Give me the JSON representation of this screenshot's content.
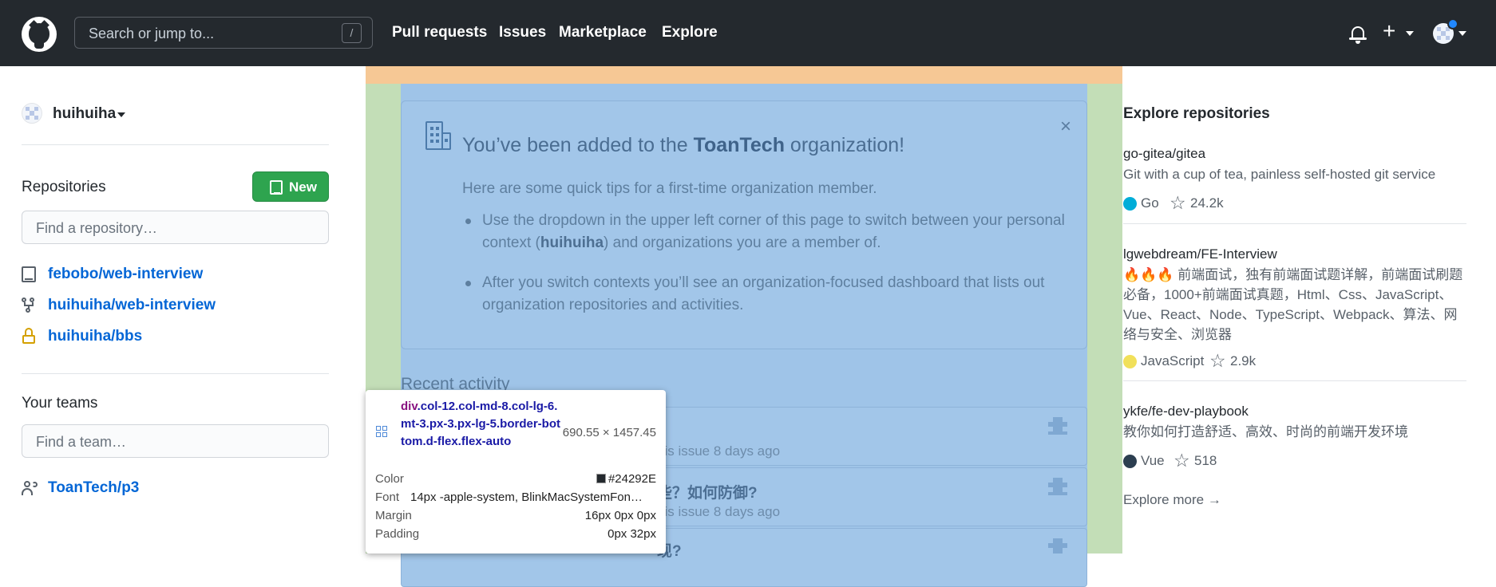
{
  "header": {
    "search_placeholder": "Search or jump to...",
    "search_shortcut": "/",
    "nav": [
      "Pull requests",
      "Issues",
      "Marketplace",
      "Explore"
    ],
    "plus_icon": "+"
  },
  "sidebar": {
    "username": "huihuiha",
    "repositories_title": "Repositories",
    "new_button": "New",
    "find_repo_placeholder": "Find a repository…",
    "repos": [
      {
        "name": "febobo/web-interview",
        "icon": "repo-icon"
      },
      {
        "name": "huihuiha/web-interview",
        "icon": "fork-icon"
      },
      {
        "name": "huihuiha/bbs",
        "icon": "lock-icon"
      }
    ],
    "teams_title": "Your teams",
    "find_team_placeholder": "Find a team…",
    "teams": [
      "ToanTech/p3"
    ]
  },
  "notice": {
    "title_prefix": "You’ve been added to the ",
    "org_name": "ToanTech",
    "title_suffix": " organization!",
    "subtitle": "Here are some quick tips for a first-time organization member.",
    "tip1_before": "Use the dropdown in the upper left corner of this page to switch between your personal context (",
    "tip1_user": "huihuiha",
    "tip1_after": ") and organizations you are a member of.",
    "tip2": "After you switch contexts you’ll see an organization-focused dashboard that lists out organization repositories and activities.",
    "close": "×"
  },
  "activity": {
    "title": "Recent activity",
    "items": [
      {
        "title": "?",
        "meta": "his issue 8 days ago"
      },
      {
        "title": "些？如何防御?",
        "meta": "his issue 8 days ago"
      },
      {
        "title": "现?",
        "meta": ""
      }
    ]
  },
  "inspector": {
    "tag": "div",
    "classes": ".col-12.col-md-8.col-lg-6.mt-3.px-3.px-lg-5.border-bottom.d-flex.flex-auto",
    "size": "690.55 × 1457.45",
    "color_label": "Color",
    "color_value": "#24292E",
    "font_label": "Font",
    "font_value": "14px -apple-system, BlinkMacSystemFon…",
    "margin_label": "Margin",
    "margin_value": "16px 0px 0px",
    "padding_label": "Padding",
    "padding_value": "0px 32px"
  },
  "explore": {
    "title": "Explore repositories",
    "repos": [
      {
        "name": "go-gitea/gitea",
        "desc": "Git with a cup of tea, painless self-hosted git service",
        "lang": "Go",
        "lang_color": "#00ADD8",
        "stars": "24.2k"
      },
      {
        "name": "lgwebdream/FE-Interview",
        "desc": "🔥🔥🔥 前端面试，独有前端面试题详解，前端面试刷题必备，1000+前端面试真题，Html、Css、JavaScript、Vue、React、Node、TypeScript、Webpack、算法、网络与安全、浏览器",
        "lang": "JavaScript",
        "lang_color": "#f1e05a",
        "stars": "2.9k"
      },
      {
        "name": "ykfe/fe-dev-playbook",
        "desc": "教你如何打造舒适、高效、时尚的前端开发环境",
        "lang": "Vue",
        "lang_color": "#2c3e50",
        "stars": "518"
      }
    ],
    "more": "Explore more →"
  },
  "colors": {
    "header_bg": "#24292e",
    "link": "#0366d6",
    "new_button": "#2ea44f",
    "overlay_content": "#9fc4e8",
    "overlay_padding": "#c3deb7",
    "overlay_margin": "#f6c895"
  }
}
